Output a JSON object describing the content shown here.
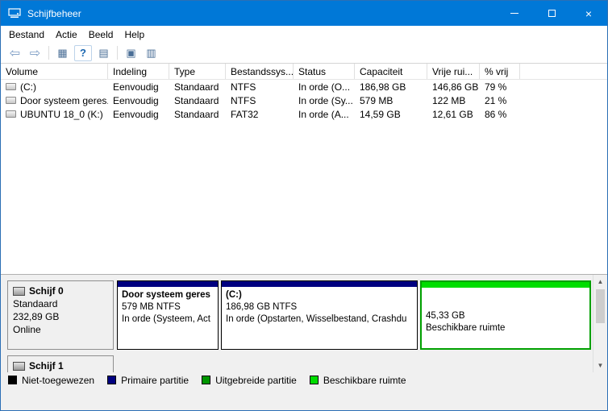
{
  "window": {
    "title": "Schijfbeheer"
  },
  "titlebar": {
    "close_glyph": "×"
  },
  "menu": {
    "items": [
      {
        "label": "Bestand"
      },
      {
        "label": "Actie"
      },
      {
        "label": "Beeld"
      },
      {
        "label": "Help"
      }
    ]
  },
  "toolbar": {
    "icons": [
      {
        "name": "back",
        "glyph": "⇦"
      },
      {
        "name": "forward",
        "glyph": "⇨"
      },
      {
        "name": "console-tree",
        "glyph": "▦"
      },
      {
        "name": "help",
        "glyph": "?"
      },
      {
        "name": "list-view",
        "glyph": "▤"
      },
      {
        "name": "action-pane",
        "glyph": "▣"
      },
      {
        "name": "graphical-view",
        "glyph": "▥"
      }
    ]
  },
  "volume_table": {
    "columns": [
      {
        "label": "Volume"
      },
      {
        "label": "Indeling"
      },
      {
        "label": "Type"
      },
      {
        "label": "Bestandssys..."
      },
      {
        "label": "Status"
      },
      {
        "label": "Capaciteit"
      },
      {
        "label": "Vrije rui..."
      },
      {
        "label": "% vrij"
      }
    ],
    "rows": [
      {
        "volume": "(C:)",
        "indeling": "Eenvoudig",
        "type": "Standaard",
        "fs": "NTFS",
        "status": "In orde (O...",
        "capacity": "186,98 GB",
        "free": "146,86 GB",
        "pct_free": "79 %"
      },
      {
        "volume": "Door systeem geres...",
        "indeling": "Eenvoudig",
        "type": "Standaard",
        "fs": "NTFS",
        "status": "In orde (Sy...",
        "capacity": "579 MB",
        "free": "122 MB",
        "pct_free": "21 %"
      },
      {
        "volume": "UBUNTU 18_0 (K:)",
        "indeling": "Eenvoudig",
        "type": "Standaard",
        "fs": "FAT32",
        "status": "In orde (A...",
        "capacity": "14,59 GB",
        "free": "12,61 GB",
        "pct_free": "86 %"
      }
    ]
  },
  "disk0": {
    "name": "Schijf 0",
    "type": "Standaard",
    "size": "232,89 GB",
    "status": "Online",
    "partitions": [
      {
        "title": "Door systeem geres",
        "size_fs": "579 MB NTFS",
        "status": "In orde (Systeem, Act"
      },
      {
        "title": "(C:)",
        "size_fs": "186,98 GB NTFS",
        "status": "In orde (Opstarten, Wisselbestand, Crashdu"
      },
      {
        "size": "45,33 GB",
        "label": "Beschikbare ruimte"
      }
    ]
  },
  "disk1": {
    "name": "Schijf 1"
  },
  "legend": {
    "items": [
      {
        "label": "Niet-toegewezen",
        "color": "#000000"
      },
      {
        "label": "Primaire partitie",
        "color": "#000080"
      },
      {
        "label": "Uitgebreide partitie",
        "color": "#009600"
      },
      {
        "label": "Beschikbare ruimte",
        "color": "#00dd00"
      }
    ]
  },
  "scrollbar": {
    "up": "▲",
    "down": "▼"
  },
  "colors": {
    "titlebar": "#0078d7",
    "primary_partition": "#000080",
    "free_space": "#00dd00",
    "selection_border": "#00a000"
  }
}
